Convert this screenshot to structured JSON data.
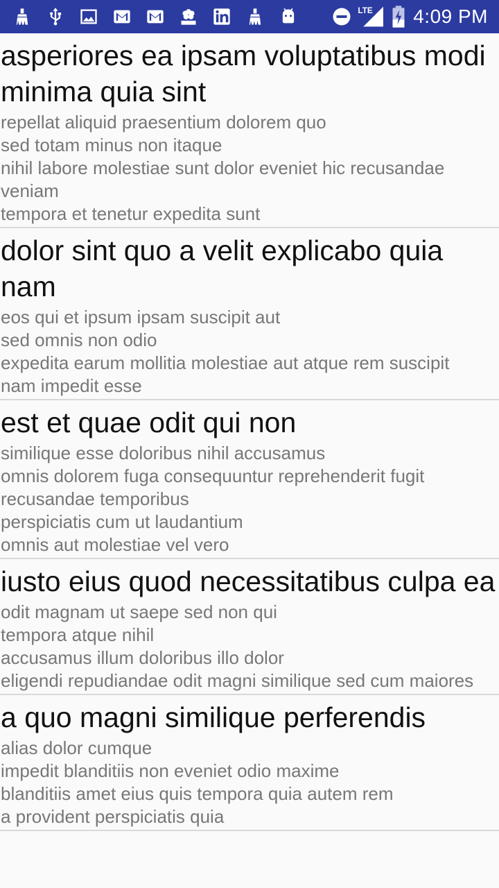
{
  "status_bar": {
    "time": "4:09 PM",
    "network_label": "LTE",
    "background_color": "#2b3ba0",
    "notification_icons": [
      "cleaner-icon",
      "usb-icon",
      "image-icon",
      "gmail-icon",
      "gmail-icon",
      "nbc-news-icon",
      "linkedin-icon",
      "cleaner-icon",
      "android-icon"
    ],
    "system_icons": [
      "do-not-disturb-icon",
      "signal-icon",
      "battery-charging-icon"
    ]
  },
  "posts": [
    {
      "title": "asperiores ea ipsam voluptatibus modi minima quia sint",
      "body": "repellat aliquid praesentium dolorem quo\nsed totam minus non itaque\nnihil labore molestiae sunt dolor eveniet hic recusandae veniam\ntempora et tenetur expedita sunt"
    },
    {
      "title": "dolor sint quo a velit explicabo quia nam",
      "body": "eos qui et ipsum ipsam suscipit aut\nsed omnis non odio\nexpedita earum mollitia molestiae aut atque rem suscipit\nnam impedit esse"
    },
    {
      "title": "est et quae odit qui non",
      "body": "similique esse doloribus nihil accusamus\nomnis dolorem fuga consequuntur reprehenderit fugit recusandae temporibus\nperspiciatis cum ut laudantium\nomnis aut molestiae vel vero"
    },
    {
      "title": "iusto eius quod necessitatibus culpa ea",
      "body": "odit magnam ut saepe sed non qui\ntempora atque nihil\naccusamus illum doloribus illo dolor\neligendi repudiandae odit magni similique sed cum maiores"
    },
    {
      "title": "a quo magni similique perferendis",
      "body": "alias dolor cumque\nimpedit blanditiis non eveniet odio maxime\nblanditiis amet eius quis tempora quia autem rem\na provident perspiciatis quia"
    }
  ]
}
